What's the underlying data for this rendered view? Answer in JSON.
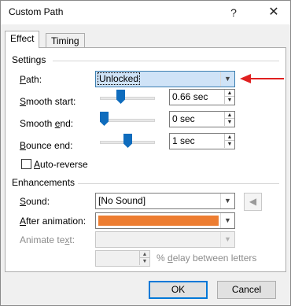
{
  "window": {
    "title": "Custom Path",
    "help_glyph": "?",
    "close_glyph": "✕"
  },
  "tabs": [
    {
      "label": "Effect",
      "active": true
    },
    {
      "label": "Timing",
      "active": false
    }
  ],
  "settings": {
    "group_label": "Settings",
    "path": {
      "label": "Path:",
      "value": "Unlocked"
    },
    "smooth_start": {
      "label": "Smooth start:",
      "value": "0.66 sec",
      "slider_level": 0.33
    },
    "smooth_end": {
      "label": "Smooth end:",
      "value": "0 sec",
      "slider_level": 0.0
    },
    "bounce_end": {
      "label": "Bounce end:",
      "value": "1 sec",
      "slider_level": 0.5
    },
    "auto_reverse": {
      "label": "Auto-reverse",
      "checked": false
    }
  },
  "enhancements": {
    "group_label": "Enhancements",
    "sound": {
      "label": "Sound:",
      "value": "[No Sound]"
    },
    "after_animation": {
      "label": "After animation:",
      "color": "#ED7D31"
    },
    "animate_text": {
      "label": "Animate text:",
      "value": ""
    },
    "delay": {
      "value": "",
      "suffix": "% delay between letters"
    }
  },
  "buttons": {
    "ok": "OK",
    "cancel": "Cancel"
  },
  "colors": {
    "accent": "#0F6CBD",
    "annotation_arrow": "#E02020"
  },
  "icons": {
    "dropdown": "chevron-down-icon",
    "spin_up": "caret-up-icon",
    "spin_down": "caret-down-icon",
    "speaker": "speaker-icon"
  }
}
